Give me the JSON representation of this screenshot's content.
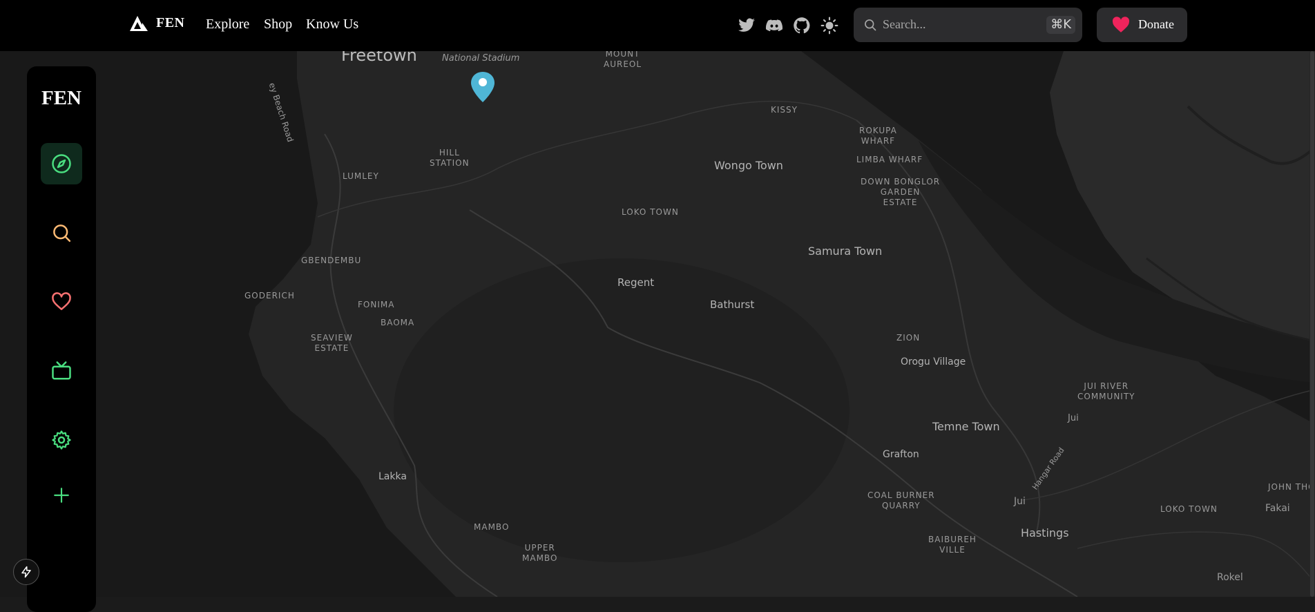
{
  "header": {
    "brand": "FEN",
    "nav": [
      "Explore",
      "Shop",
      "Know Us"
    ],
    "social_icons": [
      "twitter-icon",
      "discord-icon",
      "github-icon",
      "theme-toggle-icon"
    ],
    "search": {
      "placeholder": "Search...",
      "shortcut": "⌘K"
    },
    "donate_label": "Donate"
  },
  "sidebar": {
    "logo": "FEN",
    "items": [
      {
        "name": "explore",
        "icon": "compass-icon",
        "color": "#4ade80",
        "active": true
      },
      {
        "name": "search",
        "icon": "search-icon",
        "color": "#fdba74",
        "active": false
      },
      {
        "name": "favorites",
        "icon": "heart-icon",
        "color": "#f87171",
        "active": false
      },
      {
        "name": "tv",
        "icon": "tv-icon",
        "color": "#4ade80",
        "active": false
      },
      {
        "name": "settings",
        "icon": "settings-icon",
        "color": "#4ade80",
        "active": false
      },
      {
        "name": "add",
        "icon": "plus-icon",
        "color": "#4ade80",
        "active": false
      }
    ]
  },
  "map": {
    "labels": {
      "freetown": "Freetown",
      "national_stadium": "National Stadium",
      "mount_aureol_1": "MOUNT",
      "mount_aureol_2": "AUREOL",
      "kissy": "KISSY",
      "rokupa_1": "ROKUPA",
      "rokupa_2": "WHARF",
      "limba_wharf": "LIMBA WHARF",
      "down_bonglor_1": "DOWN BONGLOR",
      "down_bonglor_2": "GARDEN",
      "down_bonglor_3": "ESTATE",
      "wongo_town": "Wongo Town",
      "hill_station_1": "HILL",
      "hill_station_2": "STATION",
      "lumley": "LUMLEY",
      "beach_road": "ey Beach Road",
      "loko_town": "LOKO TOWN",
      "samura_town": "Samura Town",
      "gbendembu": "GBENDEMBU",
      "goderich": "GODERICH",
      "fonima": "FONIMA",
      "baoma": "BAOMA",
      "regent": "Regent",
      "bathurst": "Bathurst",
      "seaview_1": "SEAVIEW",
      "seaview_2": "ESTATE",
      "zion": "ZION",
      "orogu_village": "Orogu Village",
      "jui_river_1": "JUI RIVER",
      "jui_river_2": "COMMUNITY",
      "jui_top": "Jui",
      "temne_town": "Temne Town",
      "grafton": "Grafton",
      "hangar_road": "Hangar Road",
      "lakka": "Lakka",
      "coal_burner_1": "COAL BURNER",
      "coal_burner_2": "QUARRY",
      "jui": "Jui",
      "loko_town_2": "LOKO TOWN",
      "fakai": "Fakai",
      "john_tho": "JOHN THO",
      "mambo": "MAMBO",
      "upper_mambo_1": "UPPER",
      "upper_mambo_2": "MAMBO",
      "baibureh_1": "BAIBUREH",
      "baibureh_2": "VILLE",
      "hastings": "Hastings",
      "rokel": "Rokel"
    },
    "marker_color": "#4fb6d6"
  }
}
